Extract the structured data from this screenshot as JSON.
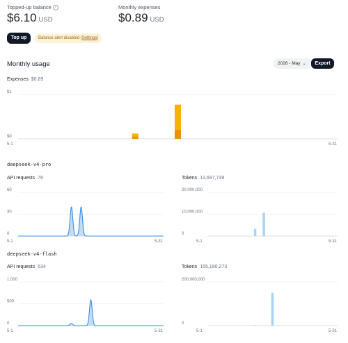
{
  "balance": {
    "label": "Topped-up balance",
    "amount": "$6.10",
    "currency": "USD"
  },
  "expenses_summary": {
    "label": "Monthly expenses",
    "amount": "$0.89",
    "currency": "USD"
  },
  "actions": {
    "top_up": "Top up",
    "alert_text": "Balance alert disabled",
    "alert_link": "Settings"
  },
  "usage": {
    "title": "Monthly usage",
    "month_select": "2026 - May",
    "export": "Export"
  },
  "icons": {
    "info": "info-icon",
    "chevron": "chevron-down-icon"
  },
  "colors": {
    "expense_bar": "#f5b400",
    "expense_bar_base": "#e8930a",
    "requests_line": "#3d8de0",
    "requests_fill": "#b9d6f4",
    "tokens_bar": "#a8d5f7"
  },
  "charts": {
    "expenses": {
      "label": "Expenses",
      "value": "$0.89"
    },
    "pro_requests": {
      "label": "API requests",
      "value": "78"
    },
    "pro_tokens": {
      "label": "Tokens",
      "value": "13,697,739"
    },
    "flash_requests": {
      "label": "API requests",
      "value": "634"
    },
    "flash_tokens": {
      "label": "Tokens",
      "value": "155,180,273"
    }
  },
  "models": {
    "pro": "deepseek-v4-pro",
    "flash": "deepseek-v4-flash"
  },
  "chart_data": [
    {
      "id": "expenses",
      "type": "bar",
      "x": [
        12,
        16
      ],
      "values": [
        0.12,
        0.77
      ],
      "base_values": [
        0.05,
        0.2
      ],
      "xlim": [
        1,
        31
      ],
      "ylim": [
        0,
        1
      ],
      "yticks": [
        "$0",
        "$1"
      ],
      "xticks": [
        "5-1",
        "5-31"
      ]
    },
    {
      "id": "pro_requests",
      "type": "area",
      "peaks": [
        {
          "x": 12,
          "y": 40
        },
        {
          "x": 14,
          "y": 40
        }
      ],
      "xlim": [
        1,
        31
      ],
      "ylim": [
        0,
        60
      ],
      "yticks": [
        "0",
        "30",
        "60"
      ],
      "xticks": [
        "5-1",
        "5-31"
      ]
    },
    {
      "id": "pro_tokens",
      "type": "bar",
      "x": [
        12,
        14
      ],
      "values": [
        3300000,
        10700000
      ],
      "xlim": [
        1,
        31
      ],
      "ylim": [
        0,
        20000000
      ],
      "yticks": [
        "0",
        "10,000,000",
        "20,000,000"
      ],
      "xticks": [
        "5-1",
        "5-31"
      ]
    },
    {
      "id": "flash_requests",
      "type": "area",
      "peaks": [
        {
          "x": 12,
          "y": 50
        },
        {
          "x": 16,
          "y": 590
        }
      ],
      "xlim": [
        1,
        31
      ],
      "ylim": [
        0,
        1000
      ],
      "yticks": [
        "0",
        "500",
        "1,000"
      ],
      "xticks": [
        "5-1",
        "5-31"
      ]
    },
    {
      "id": "flash_tokens",
      "type": "bar",
      "x": [
        12,
        16
      ],
      "values": [
        1800000,
        150000000
      ],
      "xlim": [
        1,
        31
      ],
      "ylim": [
        0,
        200000000
      ],
      "yticks": [
        "0",
        "200,000,000"
      ],
      "xticks": [
        "5-1",
        "5-31"
      ]
    }
  ]
}
